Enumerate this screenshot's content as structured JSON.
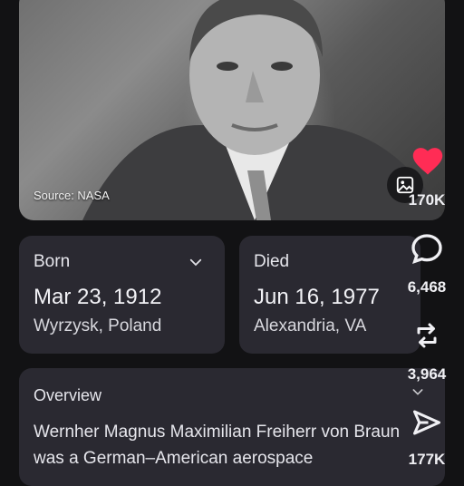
{
  "photo": {
    "source": "Source: NASA"
  },
  "born": {
    "label": "Born",
    "date": "Mar 23, 1912",
    "place": "Wyrzysk, Poland"
  },
  "died": {
    "label": "Died",
    "date": "Jun 16, 1977",
    "place": "Alexandria, VA"
  },
  "overview": {
    "label": "Overview",
    "text": "Wernher Magnus Maximilian Freiherr von Braun was a German–American aerospace"
  },
  "actions": {
    "likes": "170K",
    "comments": "6,468",
    "reposts": "3,964",
    "shares": "177K"
  },
  "colors": {
    "like": "#ff2c55",
    "card": "#2a2931",
    "background": "#121214"
  },
  "icons": [
    "image-icon",
    "heart-icon",
    "comment-icon",
    "repost-icon",
    "share-icon",
    "chevron-down-icon"
  ]
}
